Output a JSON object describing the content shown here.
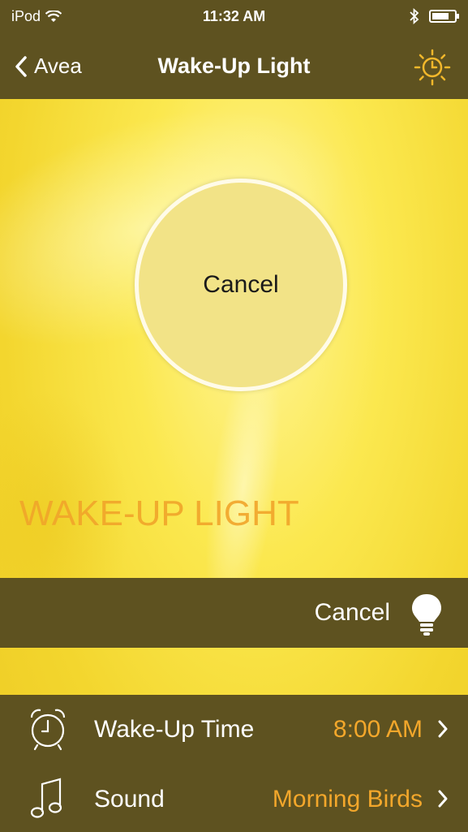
{
  "status": {
    "device": "iPod",
    "time": "11:32 AM"
  },
  "nav": {
    "back_label": "Avea",
    "title": "Wake-Up Light"
  },
  "main": {
    "circle_button": "Cancel",
    "big_label": "WAKE-UP LIGHT"
  },
  "cancel_bar": {
    "label": "Cancel"
  },
  "settings": [
    {
      "icon": "alarm-clock-icon",
      "label": "Wake-Up Time",
      "value": "8:00 AM"
    },
    {
      "icon": "music-note-icon",
      "label": "Sound",
      "value": "Morning Birds"
    }
  ],
  "colors": {
    "bar": "#5e5220",
    "accent": "#f3a72b",
    "background": "#fbe84f",
    "circle": "#f2e387"
  }
}
